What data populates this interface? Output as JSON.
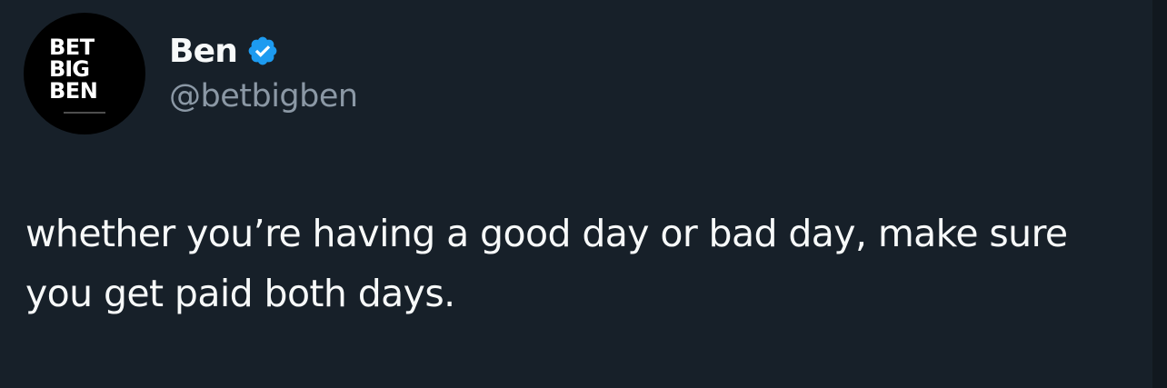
{
  "author": {
    "avatar_logo_lines": [
      "BET",
      "BIG",
      "BEN"
    ],
    "display_name": "Ben",
    "handle": "@betbigben",
    "verified": true,
    "verified_icon": "verified-badge-icon"
  },
  "tweet": {
    "text": "whether you’re having a good day or bad day, make sure you get paid both days."
  },
  "colors": {
    "background": "#172029",
    "text_primary": "#f7f9f9",
    "text_secondary": "#8b98a5",
    "verified_blue": "#1d9bf0"
  }
}
